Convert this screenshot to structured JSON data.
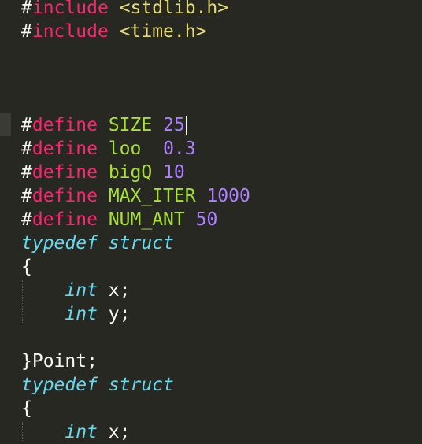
{
  "editor": {
    "lines": [
      {
        "hash": "#",
        "directive": "include",
        "sp": " ",
        "arg": "<stdlib.h>"
      },
      {
        "hash": "#",
        "directive": "include",
        "sp": " ",
        "arg": "<time.h>"
      },
      {
        "hash": "#",
        "directive": "define",
        "sp": " ",
        "name": "SIZE",
        "sp2": " ",
        "value": "25"
      },
      {
        "hash": "#",
        "directive": "define",
        "sp": " ",
        "name": "loo",
        "sp2": "  ",
        "value": "0.3"
      },
      {
        "hash": "#",
        "directive": "define",
        "sp": " ",
        "name": "bigQ",
        "sp2": " ",
        "value": "10"
      },
      {
        "hash": "#",
        "directive": "define",
        "sp": " ",
        "name": "MAX_ITER",
        "sp2": " ",
        "value": "1000"
      },
      {
        "hash": "#",
        "directive": "define",
        "sp": " ",
        "name": "NUM_ANT",
        "sp2": " ",
        "value": "50"
      },
      {
        "kw1": "typedef",
        "sp": " ",
        "kw2": "struct"
      },
      {
        "text": "{"
      },
      {
        "indent": "    ",
        "type": "int",
        "rest": " x;"
      },
      {
        "indent": "    ",
        "type": "int",
        "rest": " y;"
      },
      {
        "text": "}Point;"
      },
      {
        "kw1": "typedef",
        "sp": " ",
        "kw2": "struct"
      },
      {
        "text": "{"
      },
      {
        "indent": "    ",
        "type": "int",
        "rest": " x;"
      }
    ]
  },
  "colors": {
    "background": "#272822",
    "preprocessor": "#F92672",
    "macro_name": "#A6E22E",
    "number": "#AE81FF",
    "string": "#E6DB74",
    "type_keyword": "#66D9EF",
    "plain_text": "#F8F8F2"
  }
}
